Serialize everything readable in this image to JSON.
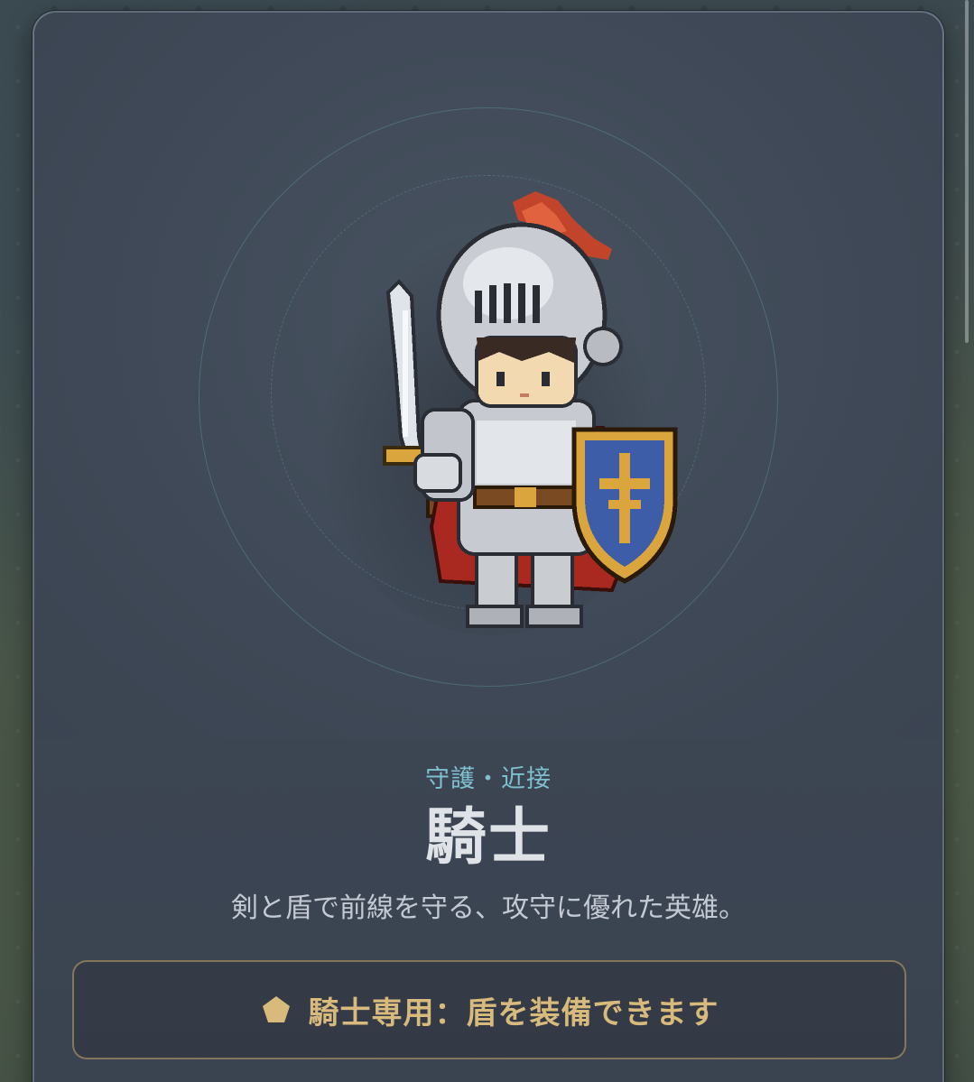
{
  "hero": {
    "role": "守護・近接",
    "name": "騎士",
    "description": "剣と盾で前線を守る、攻守に優れた英雄。",
    "sprite_icon": "knight-sprite"
  },
  "perk": {
    "icon": "pentagon-icon",
    "text": "騎士専用：盾を装備できます"
  },
  "colors": {
    "role_text": "#7dc0cf",
    "perk_text": "#d8ba7c",
    "perk_border": "#c8aa6e",
    "card_bg": "#3d4654"
  }
}
